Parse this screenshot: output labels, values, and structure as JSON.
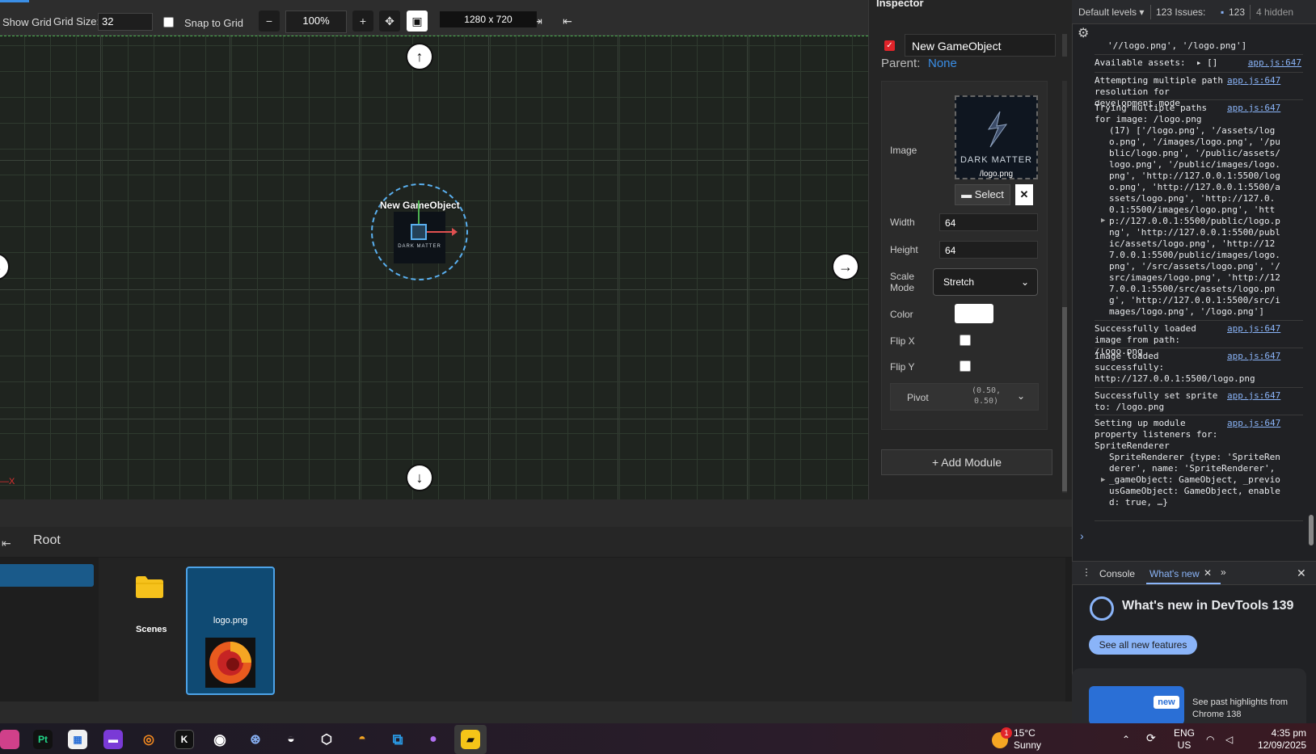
{
  "toolbar": {
    "show_grid_label": "Show Grid",
    "grid_size_label": "Grid Size:",
    "grid_size_value": "32",
    "snap_label": "Snap to Grid",
    "zoom_value": "100%"
  },
  "viewport": {
    "resolution_label": "1280 x 720",
    "gameobject_label": "New GameObject",
    "sprite_text": "DARK MATTER",
    "axis_x_label": "X"
  },
  "inspector": {
    "title": "Inspector",
    "object_name": "New GameObject",
    "parent_label": "Parent:",
    "parent_value": "None",
    "image_label": "Image",
    "image_logo_text": "DARK MATTER",
    "image_filename": "/logo.png",
    "select_label": "Select",
    "width_label": "Width",
    "width_value": "64",
    "height_label": "Height",
    "height_value": "64",
    "scale_mode_label_1": "Scale",
    "scale_mode_label_2": "Mode",
    "scale_mode_value": "Stretch",
    "color_label": "Color",
    "color_value": "#ffffff",
    "flip_x_label": "Flip X",
    "flip_y_label": "Flip Y",
    "pivot_label": "Pivot",
    "pivot_value_1": "(0.50,",
    "pivot_value_2": "0.50)",
    "add_module_label": "+ Add Module"
  },
  "assets": {
    "breadcrumb": "Root",
    "items": [
      {
        "name": "Scenes",
        "icon": "folder-icon"
      },
      {
        "name": "logo.png",
        "icon": "image-thumbnail"
      }
    ]
  },
  "devtools": {
    "levels_label": "Default levels ▾",
    "issues_label": "123 Issues:",
    "issues_count": "123",
    "hidden_label": "4 hidden",
    "logs": {
      "l0": "'//logo.png', '/logo.png']",
      "l1_text": "Available assets:  ▸ []",
      "l2_text": "Attempting multiple path resolution for development mode",
      "l3_text": "Trying multiple paths for image: /logo.png",
      "l3_array": "(17) ['/logo.png', '/assets/logo.png', '/images/logo.png', '/public/logo.png', '/public/assets/logo.png', '/public/images/logo.png', 'http://127.0.0.1:5500/logo.png', 'http://127.0.0.1:5500/assets/logo.png', 'http://127.0.0.1:5500/images/logo.png', 'http://127.0.0.1:5500/public/logo.png', 'http://127.0.0.1:5500/public/assets/logo.png', 'http://127.0.0.1:5500/public/images/logo.png', '/src/assets/logo.png', '/src/images/logo.png', 'http://127.0.0.1:5500/src/assets/logo.png', 'http://127.0.0.1:5500/src/images/logo.png', '/logo.png']",
      "l4_text": "Successfully loaded image from path: /logo.png",
      "l5_text": "Image loaded successfully:",
      "l5_url": "http://127.0.0.1:5500/logo.png",
      "l6_text": "Successfully set sprite to: /logo.png",
      "l7_text": "Setting up module property listeners for: SpriteRenderer",
      "l7_obj": "SpriteRenderer {type: 'SpriteRenderer', name: 'SpriteRenderer', _gameObject: GameObject, _previousGameObject: GameObject, enabled: true, …}",
      "source": "app.js:647"
    },
    "tab_console": "Console",
    "tab_whats_new": "What's new",
    "whats_new_title": "What's new in DevTools 139",
    "see_all_label": "See all new features",
    "new_badge": "new",
    "highlights_text": "See past highlights from Chrome 138"
  },
  "taskbar": {
    "weather_badge": "1",
    "weather_temp": "15°C",
    "weather_desc": "Sunny",
    "lang_1": "ENG",
    "lang_2": "US",
    "time": "4:35 pm",
    "date": "12/09/2025",
    "apps": [
      "app-1",
      "pycharm-icon",
      "store-icon",
      "clapper-icon",
      "blender-icon",
      "kdenlive-icon",
      "obs-icon",
      "steam-icon",
      "game-icon",
      "unity-icon",
      "ubisoft-icon",
      "vscode-icon",
      "github-icon",
      "sticky-notes-icon"
    ]
  }
}
